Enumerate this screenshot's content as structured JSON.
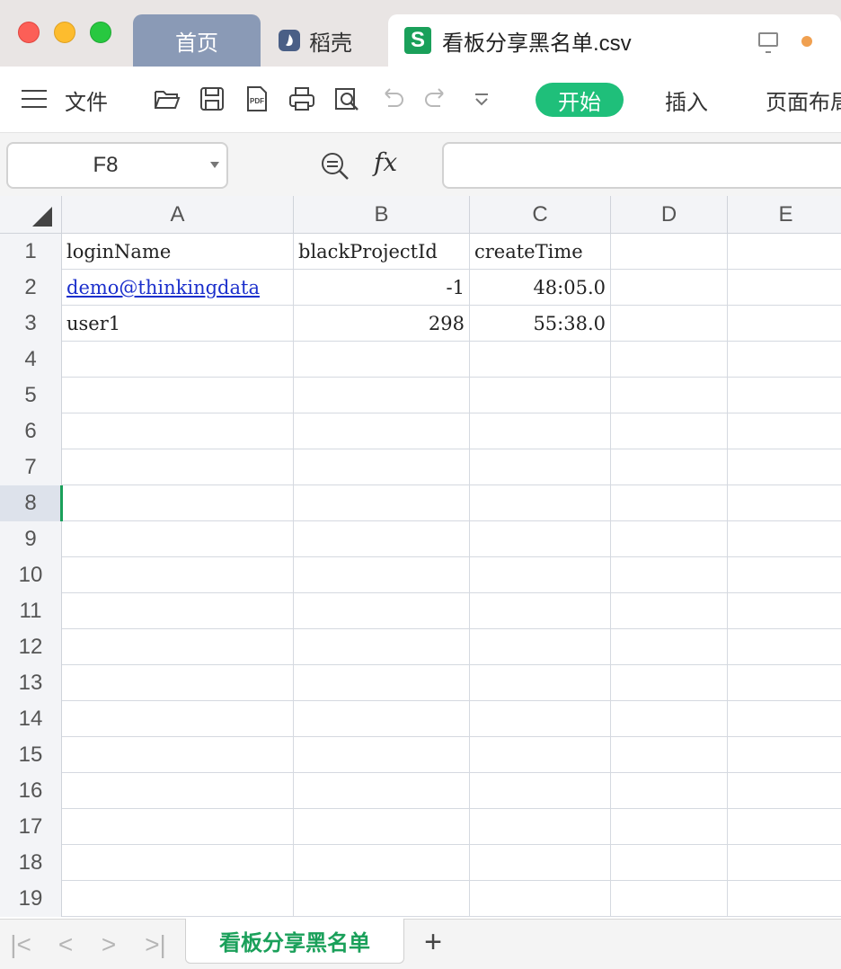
{
  "tabs": {
    "home": "首页",
    "daoke": "稻壳",
    "file": "看板分享黑名单.csv",
    "file_icon_letter": "S"
  },
  "toolbar": {
    "file_menu": "文件",
    "start": "开始",
    "insert": "插入",
    "page_layout": "页面布局"
  },
  "formula": {
    "cell_ref": "F8",
    "fx_label": "fx",
    "value": ""
  },
  "columns": [
    "A",
    "B",
    "C",
    "D",
    "E"
  ],
  "rows": [
    {
      "num": "1",
      "a": "loginName",
      "b": "blackProjectId",
      "c": "createTime"
    },
    {
      "num": "2",
      "a": "demo@thinkingdata",
      "b": "-1",
      "c": "48:05.0"
    },
    {
      "num": "3",
      "a": "user1",
      "b": "298",
      "c": "55:38.0"
    },
    {
      "num": "4"
    },
    {
      "num": "5"
    },
    {
      "num": "6"
    },
    {
      "num": "7"
    },
    {
      "num": "8"
    },
    {
      "num": "9"
    },
    {
      "num": "10"
    },
    {
      "num": "11"
    },
    {
      "num": "12"
    },
    {
      "num": "13"
    },
    {
      "num": "14"
    },
    {
      "num": "15"
    },
    {
      "num": "16"
    },
    {
      "num": "17"
    },
    {
      "num": "18"
    },
    {
      "num": "19"
    }
  ],
  "sheet": {
    "name": "看板分享黑名单",
    "add": "+",
    "nav_first": "|<",
    "nav_prev": "<",
    "nav_next": ">",
    "nav_last": ">|"
  },
  "colors": {
    "accent_green": "#1fbf7a",
    "sheet_green": "#1aa05a",
    "link_blue": "#1b2fcc"
  }
}
